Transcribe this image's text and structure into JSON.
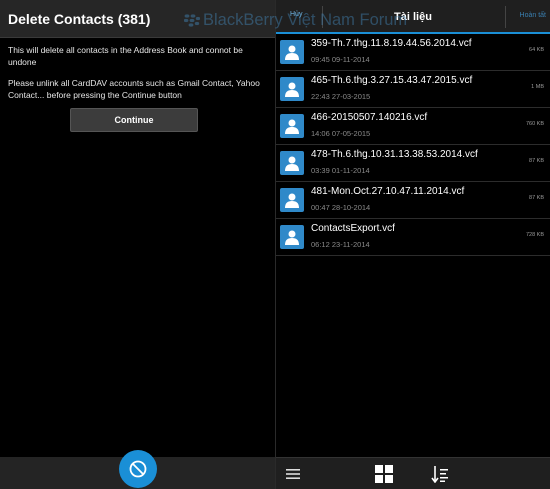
{
  "left_panel": {
    "title": "Delete Contacts (381)",
    "message1": "This will delete all contacts in the Address Book and connot be undone",
    "message2": "Please unlink all CardDAV accounts such as Gmail Contact, Yahoo Contact... before pressing the Continue button",
    "continue_label": "Continue",
    "fab_icon": "prohibited-icon"
  },
  "right_panel": {
    "cancel_label": "Hủy",
    "title": "Tài liệu",
    "done_label": "Hoàn tất",
    "files": [
      {
        "name": "359-Th.7.thg.11.8.19.44.56.2014.vcf",
        "date": "09:45 09-11-2014",
        "size": "64 KB"
      },
      {
        "name": "465-Th.6.thg.3.27.15.43.47.2015.vcf",
        "date": "22:43 27-03-2015",
        "size": "1 MB"
      },
      {
        "name": "466-20150507.140216.vcf",
        "date": "14:06 07-05-2015",
        "size": "760 KB"
      },
      {
        "name": "478-Th.6.thg.10.31.13.38.53.2014.vcf",
        "date": "03:39 01-11-2014",
        "size": "87 KB"
      },
      {
        "name": "481-Mon.Oct.27.10.47.11.2014.vcf",
        "date": "00:47 28-10-2014",
        "size": "87 KB"
      },
      {
        "name": "ContactsExport.vcf",
        "date": "06:12 23-11-2014",
        "size": "728 KB"
      }
    ],
    "footer_icons": [
      "menu-icon",
      "grid-view-icon",
      "sort-icon"
    ]
  },
  "watermark": {
    "text": "BlackBerry Việt Nam Forum"
  },
  "colors": {
    "accent": "#1a8fd6",
    "file_icon": "#2f89c9",
    "background": "#000000",
    "header": "#262626"
  }
}
